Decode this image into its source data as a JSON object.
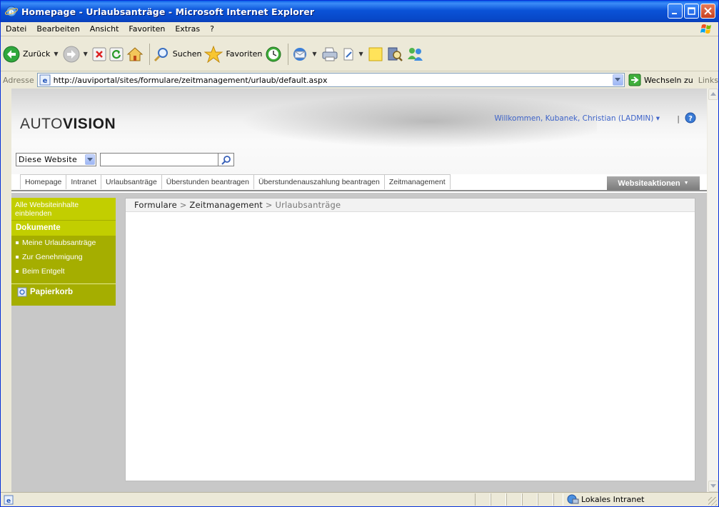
{
  "window": {
    "title": "Homepage - Urlaubsanträge - Microsoft Internet Explorer"
  },
  "menu": [
    "Datei",
    "Bearbeiten",
    "Ansicht",
    "Favoriten",
    "Extras",
    "?"
  ],
  "toolbar": {
    "back": "Zurück",
    "search": "Suchen",
    "favorites": "Favoriten"
  },
  "address": {
    "label": "Adresse",
    "url": "http://auviportal/sites/formulare/zeitmanagement/urlaub/default.aspx",
    "go": "Wechseln zu",
    "links": "Links"
  },
  "site": {
    "logo_light": "AUTO",
    "logo_bold": "VISION",
    "welcome": "Willkommen, Kubanek, Christian (LADMIN) ▾",
    "welcome_sep": "|",
    "search_scope": "Diese Website",
    "nav_tabs": [
      "Homepage",
      "Intranet",
      "Urlaubsanträge",
      "Überstunden beantragen",
      "Überstundenauszahlung beantragen",
      "Zeitmanagement"
    ],
    "site_actions": "Websiteaktionen"
  },
  "quicklaunch": {
    "view_all": "Alle Websiteinhalte einblenden",
    "header": "Dokumente",
    "items": [
      "Meine Urlaubsanträge",
      "Zur Genehmigung",
      "Beim Entgelt"
    ],
    "recycle": "Papierkorb"
  },
  "breadcrumb": {
    "part1": "Formulare",
    "sep": ">",
    "part2": "Zeitmanagement",
    "current": "Urlaubsanträge"
  },
  "statusbar": {
    "zone": "Lokales Intranet"
  }
}
